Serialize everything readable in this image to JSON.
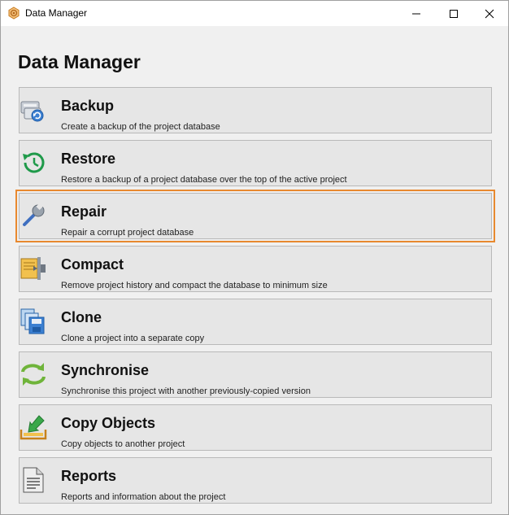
{
  "window": {
    "title": "Data Manager",
    "icon": "app-logo-icon"
  },
  "heading": "Data Manager",
  "options": [
    {
      "title": "Backup",
      "description": "Create a backup of the project database",
      "icon": "backup-icon"
    },
    {
      "title": "Restore",
      "description": "Restore a backup of a project database over the top of the active project",
      "icon": "restore-icon"
    },
    {
      "title": "Repair",
      "description": "Repair a corrupt project database",
      "icon": "wrench-icon",
      "selected": true
    },
    {
      "title": "Compact",
      "description": "Remove project history and compact the database to minimum size",
      "icon": "compact-icon"
    },
    {
      "title": "Clone",
      "description": "Clone a project into a separate copy",
      "icon": "clone-icon"
    },
    {
      "title": "Synchronise",
      "description": "Synchronise this project with another previously-copied version",
      "icon": "sync-icon"
    },
    {
      "title": "Copy Objects",
      "description": "Copy objects to another project",
      "icon": "copy-objects-icon"
    },
    {
      "title": "Reports",
      "description": "Reports and information about the project",
      "icon": "reports-icon"
    }
  ],
  "colors": {
    "selection_outline": "#e8892f",
    "button_face": "#e6e6e6",
    "button_border": "#b9b9b9"
  }
}
